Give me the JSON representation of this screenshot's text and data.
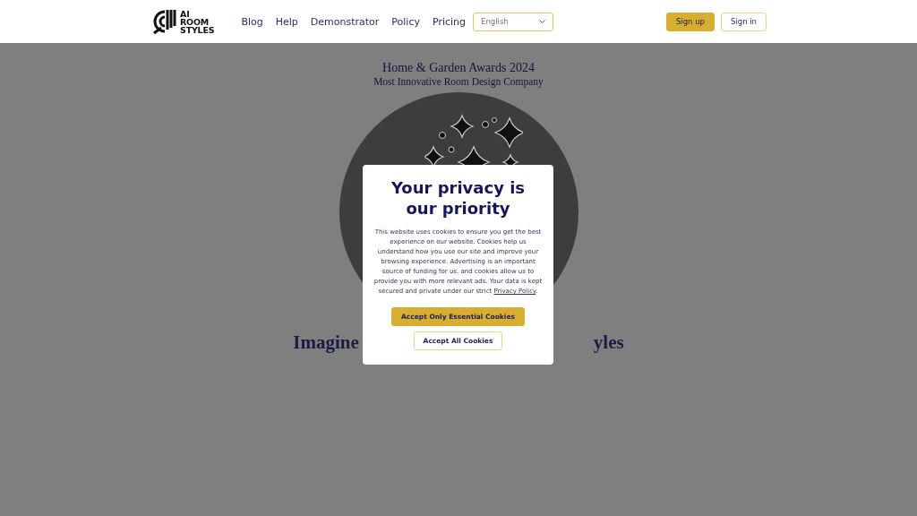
{
  "header": {
    "logo": {
      "lines": [
        "AI",
        "ROOM",
        "STYLES"
      ]
    },
    "nav": [
      "Blog",
      "Help",
      "Demonstrator",
      "Policy",
      "Pricing"
    ],
    "language_select": {
      "value": "English"
    },
    "buttons": [
      {
        "label": "Sign up",
        "kind": "primary"
      },
      {
        "label": "Sign in",
        "kind": "secondary"
      }
    ]
  },
  "hero": {
    "award_title": "Home & Garden Awards 2024",
    "award_subtitle": "Most Innovative Room Design Company",
    "headline_left": "Imagine",
    "headline_right": "yles"
  },
  "cookie_dialog": {
    "title": "Your privacy is our priority",
    "text": "This website uses cookies to ensure you get the best experience on our website. Cookies help us understand how you use our site and improve your browsing experience. Advertising is an important source of funding for us, and cookies allow us to provide you with more relevant ads. Your data is kept secured and private under our strict",
    "link": "Privacy Policy",
    "suffix": ".",
    "buttons": [
      {
        "label": "Accept Only Essential Cookies",
        "kind": "primary"
      },
      {
        "label": "Accept All Cookies",
        "kind": "secondary"
      }
    ]
  }
}
